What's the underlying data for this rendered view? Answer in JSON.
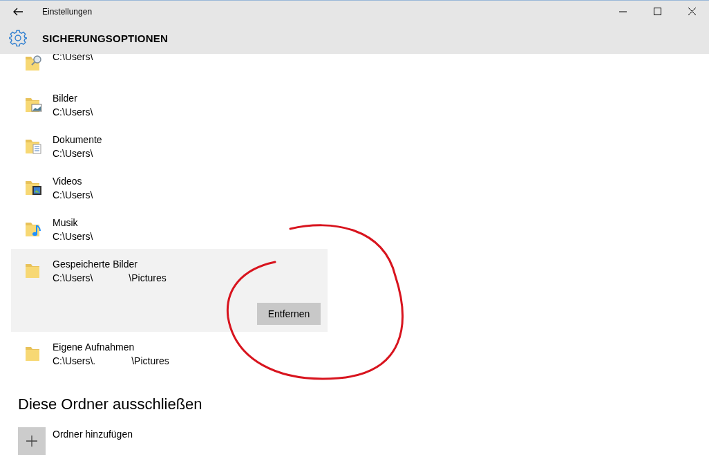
{
  "window": {
    "title": "Einstellungen"
  },
  "header": {
    "title": "SICHERUNGSOPTIONEN"
  },
  "folders": [
    {
      "kind": "search",
      "path": "C:\\Users\\",
      "selected": false
    },
    {
      "kind": "pictures",
      "name": "Bilder",
      "path": "C:\\Users\\",
      "selected": false
    },
    {
      "kind": "documents",
      "name": "Dokumente",
      "path": "C:\\Users\\",
      "selected": false
    },
    {
      "kind": "videos",
      "name": "Videos",
      "path": "C:\\Users\\",
      "selected": false
    },
    {
      "kind": "music",
      "name": "Musik",
      "path": "C:\\Users\\",
      "selected": false
    },
    {
      "kind": "plain",
      "name": "Gespeicherte Bilder",
      "path": "C:\\Users\\",
      "path_end": "\\Pictures",
      "selected": true,
      "action": "Entfernen"
    },
    {
      "kind": "plain",
      "name": "Eigene Aufnahmen",
      "path": "C:\\Users\\.",
      "path_end": "\\Pictures",
      "selected": false
    }
  ],
  "exclude": {
    "heading": "Diese Ordner ausschließen",
    "add_label": "Ordner hinzufügen"
  }
}
